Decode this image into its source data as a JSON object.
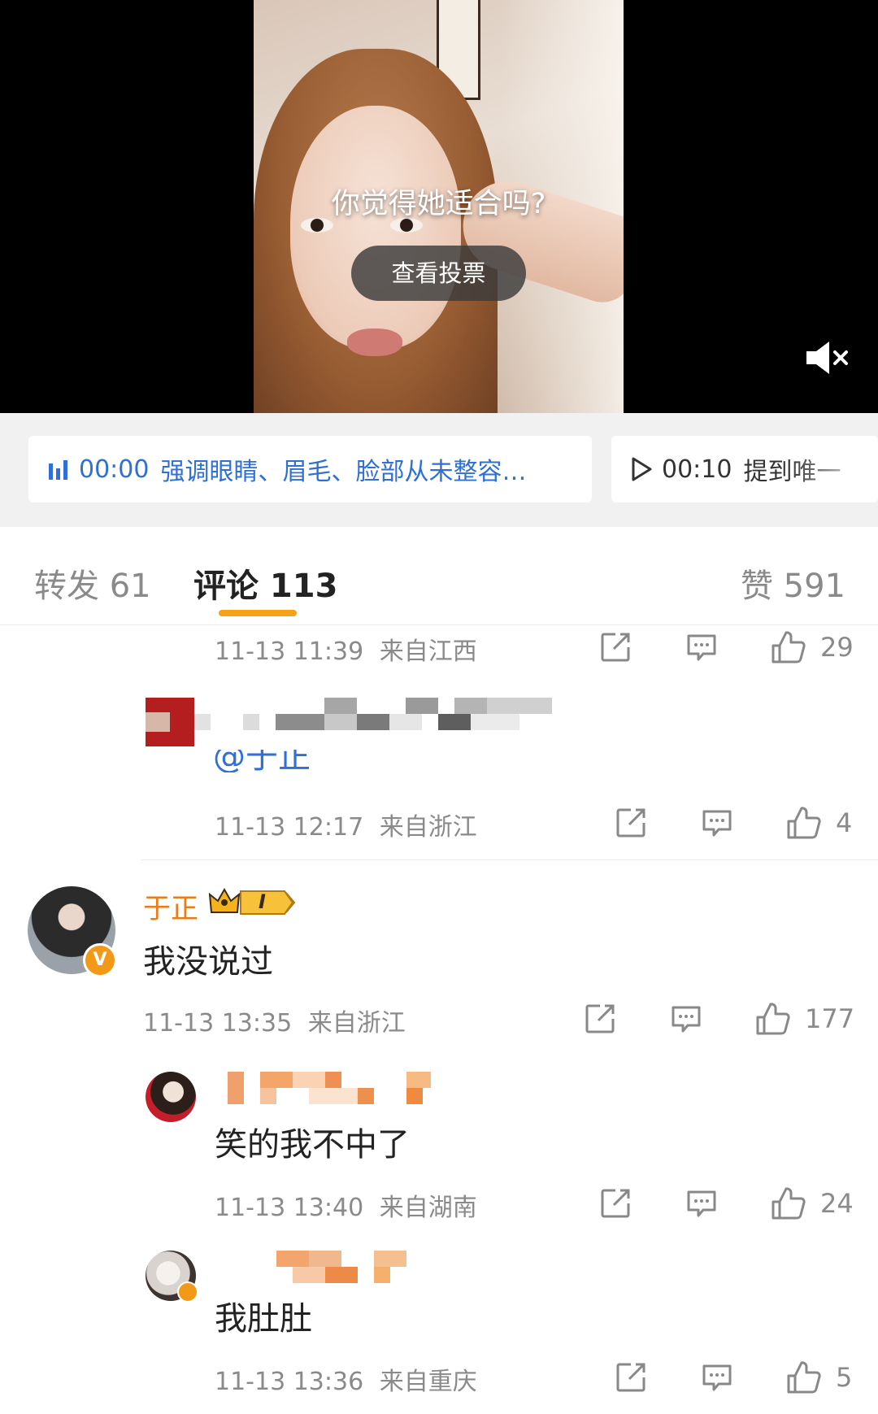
{
  "video": {
    "caption": "你觉得她适合吗?",
    "vote_button": "查看投票"
  },
  "chapters": [
    {
      "time": "00:00",
      "title": "强调眼睛、眉毛、脸部从未整容…",
      "state": "playing"
    },
    {
      "time": "00:10",
      "title": "提到唯一",
      "state": "next"
    }
  ],
  "tabs": {
    "repost": "转发 61",
    "comments": "评论 113",
    "likes": "赞 591"
  },
  "comments": [
    {
      "id": "c1",
      "timestamp": "11-13 11:39",
      "location": "来自江西",
      "likes": "29"
    },
    {
      "id": "c2",
      "mention": "@于正",
      "timestamp": "11-13 12:17",
      "location": "来自浙江",
      "likes": "4"
    },
    {
      "id": "c3",
      "author": "于正",
      "badge": "I",
      "text": "我没说过",
      "timestamp": "11-13 13:35",
      "location": "来自浙江",
      "likes": "177"
    },
    {
      "id": "c4",
      "text": "笑的我不中了",
      "timestamp": "11-13 13:40",
      "location": "来自湖南",
      "likes": "24"
    },
    {
      "id": "c5",
      "text": "我肚肚",
      "timestamp": "11-13 13:36",
      "location": "来自重庆",
      "likes": "5"
    }
  ],
  "icons": {
    "mute": "speaker-muted-icon",
    "chapter_playing": "equalizer-icon",
    "chapter_next": "play-icon",
    "share": "share-icon",
    "reply": "comment-icon",
    "like": "thumbs-up-icon",
    "verified": "verified-badge-icon",
    "crown": "crown-icon"
  },
  "colors": {
    "accent_orange": "#f7a216",
    "link_blue": "#2f6fd6",
    "name_orange": "#ea7d1a"
  }
}
